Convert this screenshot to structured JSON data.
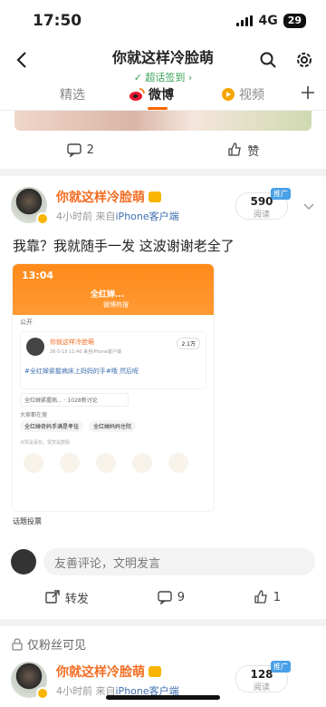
{
  "status": {
    "time": "17:50",
    "network": "4G",
    "battery": "29"
  },
  "nav": {
    "title": "你就这样冷脸萌",
    "subtitle": "✓ 超话签到 ›"
  },
  "tabs": [
    {
      "label": "精选",
      "active": false
    },
    {
      "label": "微博",
      "active": true
    },
    {
      "label": "视频",
      "active": false
    }
  ],
  "prev_actions": {
    "comments": "2",
    "like": "赞"
  },
  "post": {
    "user": "你就这样冷脸萌",
    "time": "4小时前",
    "source_prefix": "来自",
    "source": "iPhone客户端",
    "reads": "590",
    "reads_label": "阅读",
    "promo": "推广",
    "text": "我靠？我就随手一发 这波谢谢老全了",
    "shot": {
      "time": "13:04",
      "title": "全红婵...",
      "subtitle": "微博热搜",
      "public": "公开",
      "mini_user": "你就这样冷脸萌",
      "mini_meta": "26-5-15 11:40 来自iPhone客户端",
      "mini_reads": "2.1万",
      "mini_text": "#全红婵紧握病床上妈妈的手#哦 然后呢",
      "topic": "全红婵紧握病... · 1028新讨论",
      "label": "大家都在搜",
      "chips": [
        "全红婵奇妈手满是孝挂",
        "全红婵妈妈住院"
      ],
      "hint": "点赞是喜欢，赞赏是鼓励",
      "footer": "话题投票"
    },
    "comment_placeholder": "友善评论，文明发言",
    "repost": "转发",
    "comments": "9",
    "likes": "1"
  },
  "fans_label": "仅粉丝可见",
  "post2": {
    "user": "你就这样冷脸萌",
    "time": "4小时前",
    "source_prefix": "来自",
    "source": "iPhone客户端",
    "reads": "128",
    "reads_label": "阅读",
    "promo": "推广"
  },
  "colors": {
    "accent": "#f36c21",
    "link": "#3f6fb0",
    "tab_underline": "#ff6600"
  }
}
